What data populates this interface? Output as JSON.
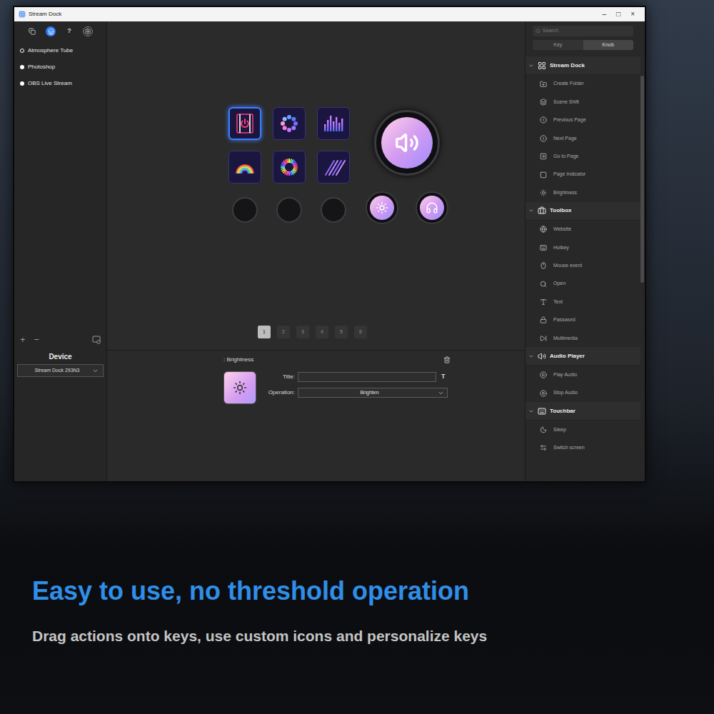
{
  "window": {
    "title": "Stream Dock",
    "controls": [
      "–",
      "□",
      "×"
    ]
  },
  "toolbar": [
    {
      "kind": "pages",
      "label": "",
      "selected": false
    },
    {
      "kind": "store",
      "label": "",
      "selected": true
    },
    {
      "kind": "help",
      "label": "?",
      "selected": false
    },
    {
      "kind": "settings",
      "label": "",
      "selected": false
    }
  ],
  "profiles": [
    {
      "name": "Atmosphere Tube",
      "selected": true
    },
    {
      "name": "Photoshop",
      "selected": false
    },
    {
      "name": "OBS Live Stream",
      "selected": false
    }
  ],
  "profile_actions": [
    "+",
    "−"
  ],
  "device": {
    "label": "Device",
    "value": "Stream Dock 293N3"
  },
  "keys": [
    {
      "kind": "power",
      "selected": true
    },
    {
      "kind": "dots",
      "selected": false
    },
    {
      "kind": "bars",
      "selected": false
    },
    {
      "kind": "arc",
      "selected": false
    },
    {
      "kind": "ring",
      "selected": false
    },
    {
      "kind": "slash",
      "selected": false
    }
  ],
  "buttons": [
    {
      "assigned": false
    },
    {
      "assigned": false
    },
    {
      "assigned": false
    }
  ],
  "knobs": [
    {
      "kind": "volume"
    },
    {
      "kind": "brightness"
    },
    {
      "kind": "headphones"
    }
  ],
  "pages": [
    {
      "label": "1",
      "selected": true
    },
    {
      "label": "2",
      "selected": false
    },
    {
      "label": "3",
      "selected": false
    },
    {
      "label": "4",
      "selected": false
    },
    {
      "label": "5",
      "selected": false
    },
    {
      "label": "6",
      "selected": false
    }
  ],
  "properties": {
    "prefix": ":",
    "title": "Brightness",
    "text_button": "T",
    "fields": [
      {
        "kind": "text",
        "label": "Title:",
        "value": ""
      },
      {
        "kind": "select",
        "label": "Operation:",
        "value": "Brighten"
      }
    ]
  },
  "actions": {
    "search": {
      "placeholder": "Search"
    },
    "tabs": [
      {
        "label": "Key",
        "selected": false
      },
      {
        "label": "Knob",
        "selected": true
      }
    ],
    "groups": [
      {
        "name": "Stream Dock",
        "kind": "dock",
        "expanded": true,
        "items": [
          {
            "label": "Create Folder",
            "kind": "folder"
          },
          {
            "label": "Scene Shift",
            "kind": "layers"
          },
          {
            "label": "Previous Page",
            "kind": "prev"
          },
          {
            "label": "Next Page",
            "kind": "next"
          },
          {
            "label": "Go to Page",
            "kind": "goto"
          },
          {
            "label": "Page Indicator",
            "kind": "indicator"
          },
          {
            "label": "Brightness",
            "kind": "brightness"
          }
        ]
      },
      {
        "name": "Toolbox",
        "kind": "toolbox",
        "expanded": true,
        "items": [
          {
            "label": "Website",
            "kind": "website"
          },
          {
            "label": "Hotkey",
            "kind": "hotkey"
          },
          {
            "label": "Mouse event",
            "kind": "mouse"
          },
          {
            "label": "Open",
            "kind": "open"
          },
          {
            "label": "Text",
            "kind": "text"
          },
          {
            "label": "Password",
            "kind": "password"
          },
          {
            "label": "Multimedia",
            "kind": "multimedia"
          }
        ]
      },
      {
        "name": "Audio Player",
        "kind": "audio",
        "expanded": true,
        "items": [
          {
            "label": "Play Audio",
            "kind": "play"
          },
          {
            "label": "Stop Audio",
            "kind": "stop"
          }
        ]
      },
      {
        "name": "Touchbar",
        "kind": "touchbar",
        "expanded": true,
        "items": [
          {
            "label": "Sleep",
            "kind": "sleep"
          },
          {
            "label": "Switch screen",
            "kind": "switch"
          }
        ]
      }
    ]
  },
  "caption": {
    "headline": "Easy to use, no threshold operation",
    "subline": "Drag actions onto keys, use custom icons and personalize keys"
  }
}
